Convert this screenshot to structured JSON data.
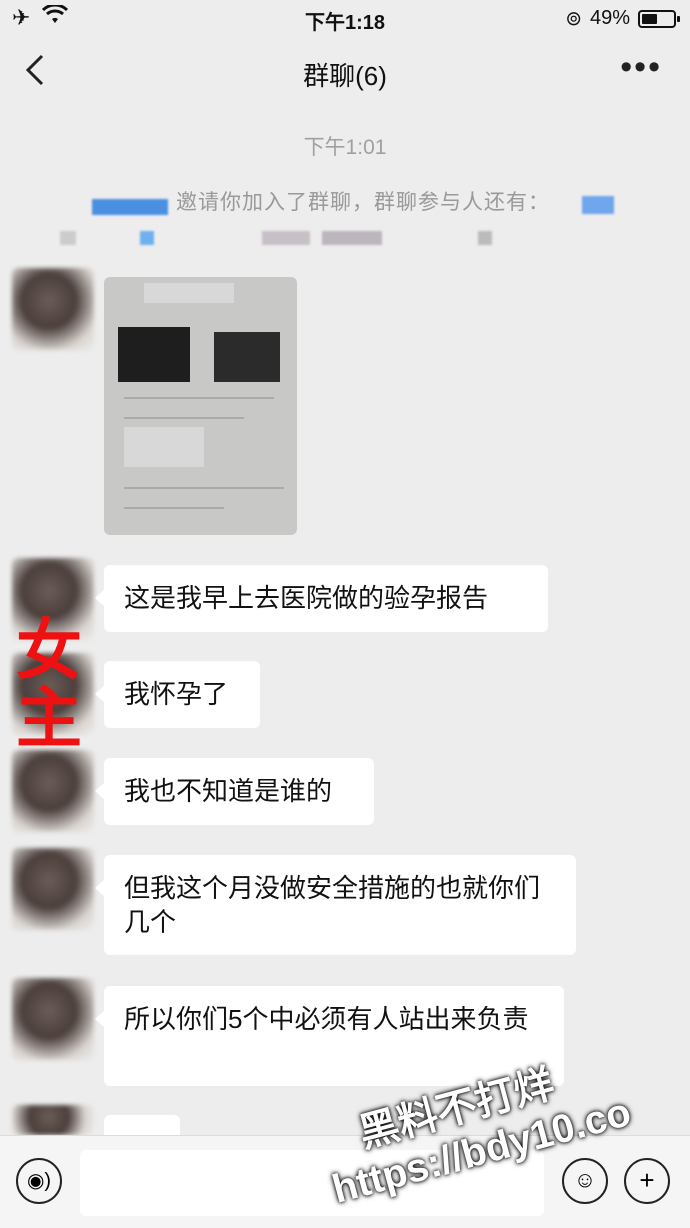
{
  "status_bar": {
    "time": "下午1:18",
    "battery_text": "49%",
    "battery_level": 0.49
  },
  "nav": {
    "title": "群聊(6)"
  },
  "chat": {
    "timestamp": "下午1:01",
    "system_message": "邀请你加入了群聊，群聊参与人还有：",
    "messages": [
      {
        "text": "这是我早上去医院做的验孕报告"
      },
      {
        "text": "我怀孕了"
      },
      {
        "text": "我也不知道是谁的"
      },
      {
        "text": "但我这个月没做安全措施的也就你们几个"
      },
      {
        "text": "所以你们5个中必须有人站出来负责"
      }
    ],
    "overlay_label": "女主"
  },
  "watermark": {
    "line1": "黑料不打烊",
    "line2": "https://bdy10.co"
  },
  "icons": {
    "wifi": "wifi-icon",
    "airplane": "airplane-icon",
    "back": "chevron-left-icon",
    "more": "more-dots-icon",
    "voice": "voice-icon",
    "emoji": "emoji-icon",
    "plus": "plus-icon"
  }
}
